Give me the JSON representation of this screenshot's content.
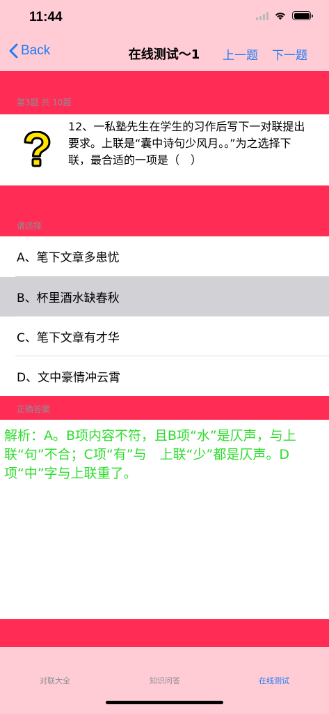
{
  "status_bar": {
    "time": "11:44"
  },
  "nav": {
    "back_label": "Back",
    "title": "在线测试～1",
    "prev_label": "上一题",
    "next_label": "下一题"
  },
  "question_header": "第3题 共 10题",
  "question": {
    "text": "12、一私塾先生在学生的习作后写下一对联提出要求。上联是“囊中诗句少风月。。”为之选择下联，最合适的一项是（　）"
  },
  "options_header": "请选择",
  "options": [
    {
      "label": "A、笔下文章多患忧"
    },
    {
      "label": "B、杯里酒水缺春秋"
    },
    {
      "label": "C、笔下文章有才华"
    },
    {
      "label": "D、文中豪情冲云霄"
    }
  ],
  "selected_option": "B",
  "answer_header": "正确答案",
  "analysis": "解析：A。B项内容不符，且B项“水”是仄声，与上联“句”不合；C项“有”与　上联“少”都是仄声。D项“中”字与上联重了。",
  "tabs": [
    {
      "label": "对联大全"
    },
    {
      "label": "知识问答"
    },
    {
      "label": "在线测试"
    }
  ],
  "active_tab": "在线测试",
  "colors": {
    "accent_band": "#ff2d55",
    "bar_pink": "#ffccd6",
    "link_blue": "#1e7cf5",
    "analysis_green": "#2ddc2d",
    "selected_gray": "#d1d1d6"
  }
}
